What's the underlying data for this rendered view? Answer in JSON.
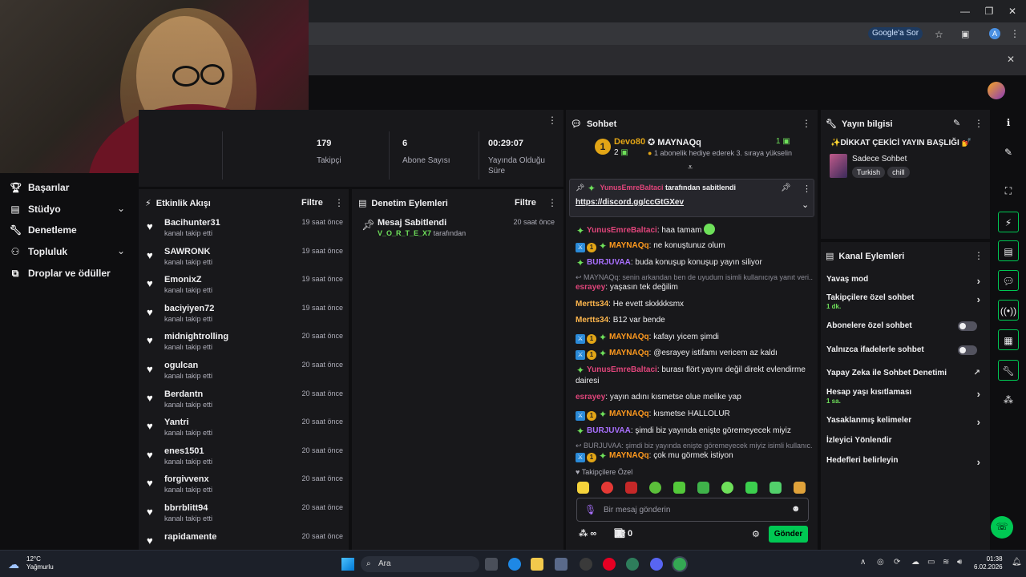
{
  "browser": {
    "google_btn": "Google'a Sor",
    "window_controls": [
      "—",
      "❐",
      "✕"
    ]
  },
  "nav": {
    "items": [
      {
        "label": "Başarılar",
        "icon": "trophy-icon"
      },
      {
        "label": "Stüdyo",
        "icon": "studio-icon"
      },
      {
        "label": "Denetleme",
        "icon": "wrench-icon"
      },
      {
        "label": "Topluluk",
        "icon": "community-icon"
      },
      {
        "label": "Droplar ve ödüller",
        "icon": "drops-icon"
      }
    ]
  },
  "stats": [
    {
      "value": "179",
      "label": "Takipçi"
    },
    {
      "value": "6",
      "label": "Abone Sayısı"
    },
    {
      "value": "00:29:07",
      "label": "Yayında Olduğu Süre"
    }
  ],
  "activity": {
    "title": "Etkinlik Akışı",
    "filter": "Filtre",
    "rows": [
      {
        "name": "Bacihunter31",
        "sub": "kanalı takip etti",
        "time": "19 saat önce"
      },
      {
        "name": "SAWRONK",
        "sub": "kanalı takip etti",
        "time": "19 saat önce"
      },
      {
        "name": "EmonixZ",
        "sub": "kanalı takip etti",
        "time": "19 saat önce"
      },
      {
        "name": "baciyiyen72",
        "sub": "kanalı takip etti",
        "time": "19 saat önce"
      },
      {
        "name": "midnightrolling",
        "sub": "kanalı takip etti",
        "time": "20 saat önce"
      },
      {
        "name": "ogulcan",
        "sub": "kanalı takip etti",
        "time": "20 saat önce"
      },
      {
        "name": "Berdantn",
        "sub": "kanalı takip etti",
        "time": "20 saat önce"
      },
      {
        "name": "Yantri",
        "sub": "kanalı takip etti",
        "time": "20 saat önce"
      },
      {
        "name": "enes1501",
        "sub": "kanalı takip etti",
        "time": "20 saat önce"
      },
      {
        "name": "forgivvenx",
        "sub": "kanalı takip etti",
        "time": "20 saat önce"
      },
      {
        "name": "bbrrblitt94",
        "sub": "kanalı takip etti",
        "time": "20 saat önce"
      },
      {
        "name": "rapidamente",
        "sub": "",
        "time": "20 saat önce"
      }
    ]
  },
  "moderation": {
    "title": "Denetim Eylemleri",
    "filter": "Filtre",
    "item_title": "Mesaj Sabitlendi",
    "item_user": "V_O_R_T_E_X7",
    "item_suffix": "tarafından",
    "item_time": "20 saat önce"
  },
  "chat": {
    "title": "Sohbet",
    "leader1": {
      "name": "Devo80",
      "rank": "1",
      "count": "2"
    },
    "leader2": {
      "name": "MAYNAQq",
      "count": "1",
      "text": "1 abonelik hediye ederek 3. sıraya yükselin"
    },
    "pinned": {
      "by": "YunusEmreBaltaci",
      "suffix": "tarafından sabitlendi",
      "link": "https://discord.gg/ccGtGXev"
    },
    "messages": [
      {
        "user": "YunusEmreBaltaci",
        "color": "#e0457b",
        "text": ": haa tamam"
      },
      {
        "user": "MAYNAQq",
        "color": "#ff9a1f",
        "text": ": ne konuştunuz olum"
      },
      {
        "user": "BURJUVAA",
        "color": "#a970ff",
        "text": ": buda konuşup konuşup yayın siliyor"
      },
      {
        "reply": "MAYNAQq: senin arkandan ben de uyudum isimli kullanıcıya yanıt veri..."
      },
      {
        "user": "esrayey",
        "color": "#e0457b",
        "text": ": yaşasın tek değilim"
      },
      {
        "user": "Mertts34",
        "color": "#ffb74d",
        "text": ": He evett skxkkksmx"
      },
      {
        "user": "Mertts34",
        "color": "#ffb74d",
        "text": ": B12 var bende"
      },
      {
        "user": "MAYNAQq",
        "color": "#ff9a1f",
        "text": ": kafayı yicem şimdi"
      },
      {
        "user": "MAYNAQq",
        "color": "#ff9a1f",
        "text": ": @esrayey istifamı vericem az kaldı"
      },
      {
        "user": "YunusEmreBaltaci",
        "color": "#e0457b",
        "text": ": burası flört yayını değil direkt evlendirme dairesi"
      },
      {
        "user": "esrayey",
        "color": "#e0457b",
        "text": ": yayın adını kısmetse olue melike yap"
      },
      {
        "user": "MAYNAQq",
        "color": "#ff9a1f",
        "text": ": kısmetse HALLOLUR"
      },
      {
        "user": "BURJUVAA",
        "color": "#a970ff",
        "text": ": şimdi biz yayında enişte göremeyecek miyiz"
      },
      {
        "reply": "BURJUVAA: şimdi biz yayında enişte göremeyecek miyiz isimli kullanıc..."
      },
      {
        "user": "MAYNAQq",
        "color": "#ff9a1f",
        "text": ": çok mu görmek istiyon"
      }
    ],
    "followers_only": "Takipçilere Özel",
    "input_placeholder": "Bir mesaj gönderin",
    "points": "∞",
    "shop_count": "0",
    "send": "Gönder"
  },
  "stream_info": {
    "title": "Yayın bilgisi",
    "stream_title": "✨DİKKAT ÇEKİCİ YAYIN BAŞLIĞI 💅",
    "category": "Sadece Sohbet",
    "tags": [
      "Turkish",
      "chill"
    ]
  },
  "channel_actions": {
    "title": "Kanal Eylemleri",
    "items": [
      {
        "label": "Yavaş mod",
        "control": "chevron"
      },
      {
        "label": "Takipçilere özel sohbet",
        "sub": "1 dk.",
        "control": "chevron"
      },
      {
        "label": "Abonelere özel sohbet",
        "control": "toggle"
      },
      {
        "label": "Yalnızca ifadelerle sohbet",
        "control": "toggle"
      },
      {
        "label": "Yapay Zeka ile Sohbet Denetimi",
        "control": "external"
      },
      {
        "label": "Hesap yaşı kısıtlaması",
        "sub": "1 sa.",
        "control": "chevron"
      },
      {
        "label": "Yasaklanmış kelimeler",
        "control": "chevron"
      },
      {
        "label": "İzleyici Yönlendir",
        "control": "none"
      },
      {
        "label": "Hedefleri belirleyin",
        "control": "chevron"
      }
    ]
  },
  "taskbar": {
    "weather_temp": "12°C",
    "weather_text": "Yağmurlu",
    "search": "Ara",
    "time": "01:38",
    "date": "6.02.2026"
  }
}
